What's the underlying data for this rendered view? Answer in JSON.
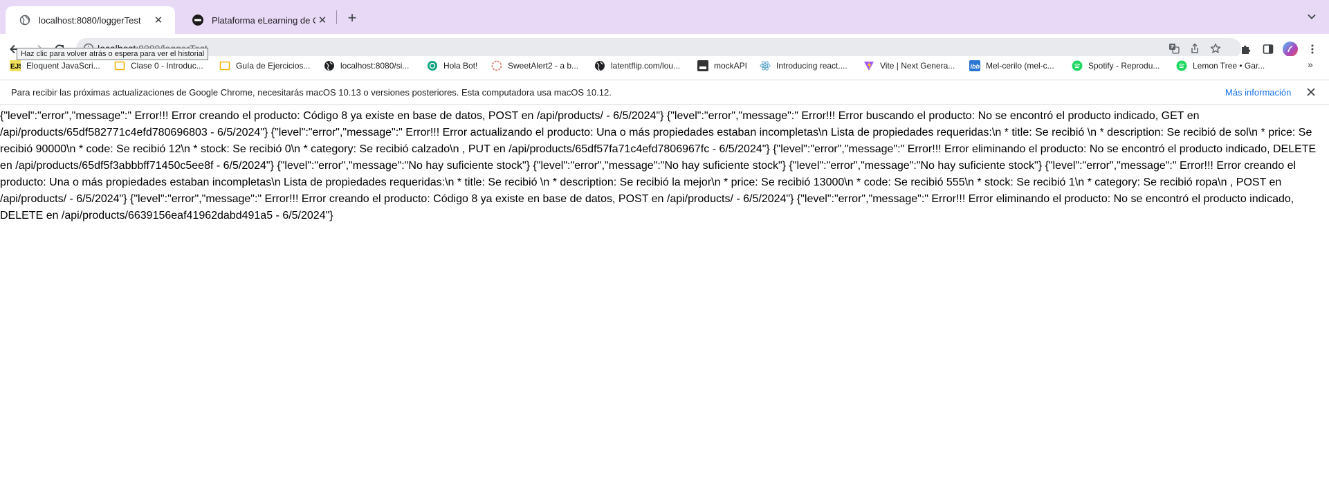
{
  "browser": {
    "tabs": [
      {
        "title": "localhost:8080/loggerTest",
        "favicon": "globe-icon",
        "active": true
      },
      {
        "title": "Plataforma eLearning de Coder",
        "favicon": "coderhouse-icon",
        "active": false
      }
    ],
    "new_tab_symbol": "+",
    "address_bar": {
      "host": "localhost",
      "rest": ":8080/loggerTest"
    },
    "tooltip": "Haz clic para volver atrás o espera para ver el historial",
    "theme_color": "#e8d9f6"
  },
  "bookmarks": [
    {
      "label": "Eloquent JavaScri...",
      "icon": "ejs-icon"
    },
    {
      "label": "Clase 0 - Introduc...",
      "icon": "folder-icon"
    },
    {
      "label": "Guía de Ejercicios...",
      "icon": "folder-icon"
    },
    {
      "label": "localhost:8080/si...",
      "icon": "globe-icon"
    },
    {
      "label": "Hola Bot!",
      "icon": "openai-icon"
    },
    {
      "label": "SweetAlert2 - a b...",
      "icon": "sweetalert-icon"
    },
    {
      "label": "latentflip.com/lou...",
      "icon": "globe-icon"
    },
    {
      "label": "mockAPI",
      "icon": "mockapi-icon"
    },
    {
      "label": "Introducing react....",
      "icon": "react-icon"
    },
    {
      "label": "Vite | Next Genera...",
      "icon": "vite-icon"
    },
    {
      "label": "Mel-cerilo (mel-c...",
      "icon": "ibb-icon"
    },
    {
      "label": "Spotify - Reprodu...",
      "icon": "spotify-icon"
    },
    {
      "label": "Lemon Tree • Gar...",
      "icon": "spotify-icon"
    }
  ],
  "bookmarks_more": "»",
  "infobar": {
    "message": "Para recibir las próximas actualizaciones de Google Chrome, necesitarás macOS 10.13 o versiones posteriores. Esta computadora usa macOS 10.12.",
    "link": "Más información"
  },
  "page": {
    "body_text": "{\"level\":\"error\",\"message\":\" Error!!! Error creando el producto: Código 8 ya existe en base de datos, POST en /api/products/ - 6/5/2024\"} {\"level\":\"error\",\"message\":\" Error!!! Error buscando el producto: No se encontró el producto indicado, GET en /api/products/65df582771c4efd780696803 - 6/5/2024\"} {\"level\":\"error\",\"message\":\" Error!!! Error actualizando el producto: Una o más propiedades estaban incompletas\\n Lista de propiedades requeridas:\\n * title: Se recibió \\n * description: Se recibió de sol\\n * price: Se recibió 90000\\n * code: Se recibió 12\\n * stock: Se recibió 0\\n * category: Se recibió calzado\\n , PUT en /api/products/65df57fa71c4efd7806967fc - 6/5/2024\"} {\"level\":\"error\",\"message\":\" Error!!! Error eliminando el producto: No se encontró el producto indicado, DELETE en /api/products/65df5f3abbbff71450c5ee8f - 6/5/2024\"} {\"level\":\"error\",\"message\":\"No hay suficiente stock\"} {\"level\":\"error\",\"message\":\"No hay suficiente stock\"} {\"level\":\"error\",\"message\":\"No hay suficiente stock\"} {\"level\":\"error\",\"message\":\" Error!!! Error creando el producto: Una o más propiedades estaban incompletas\\n Lista de propiedades requeridas:\\n * title: Se recibió \\n * description: Se recibió la mejor\\n * price: Se recibió 13000\\n * code: Se recibió 555\\n * stock: Se recibió 1\\n * category: Se recibió ropa\\n , POST en /api/products/ - 6/5/2024\"} {\"level\":\"error\",\"message\":\" Error!!! Error creando el producto: Código 8 ya existe en base de datos, POST en /api/products/ - 6/5/2024\"} {\"level\":\"error\",\"message\":\" Error!!! Error eliminando el producto: No se encontró el producto indicado, DELETE en /api/products/6639156eaf41962dabd491a5 - 6/5/2024\"}"
  }
}
